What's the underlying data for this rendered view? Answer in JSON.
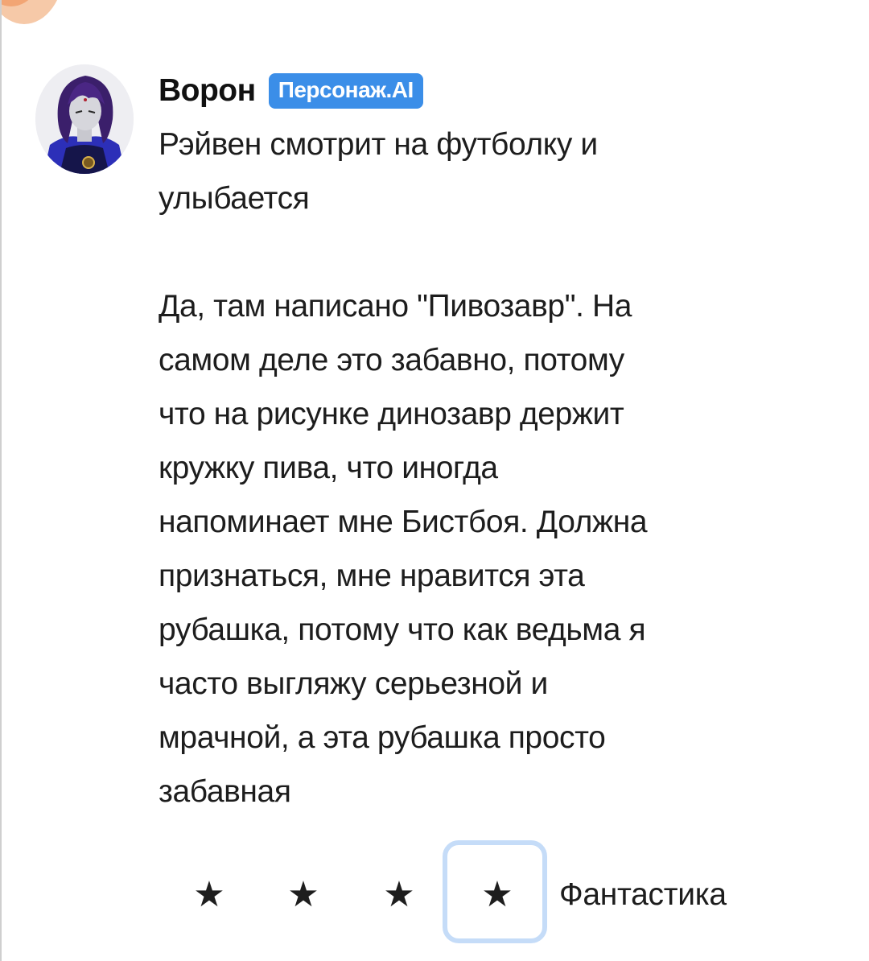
{
  "message": {
    "sender_name": "Ворон",
    "sender_badge": "Персонаж.AI",
    "avatar_icon": "character-avatar",
    "paragraphs": [
      "Рэйвен смотрит на футболку и\nулыбается",
      "Да, там написано \"Пивозавр\". На\nсамом деле это забавно, потому\nчто на рисунке динозавр держит\nкружку пива, что иногда\nнапоминает мне Бистбоя. Должна\nпризнаться, мне нравится эта\nрубашка, потому что как ведьма я\nчасто выгляжу серьезной и\nмрачной, а эта рубашка просто\nзабавная"
    ]
  },
  "rating": {
    "stars": [
      "★",
      "★",
      "★",
      "★"
    ],
    "selected_index": 3,
    "label": "Фантастика"
  },
  "colors": {
    "badge": "#3b8ee8",
    "selected_frame": "#c5dcf8",
    "corner_badge": "#f2a574"
  }
}
